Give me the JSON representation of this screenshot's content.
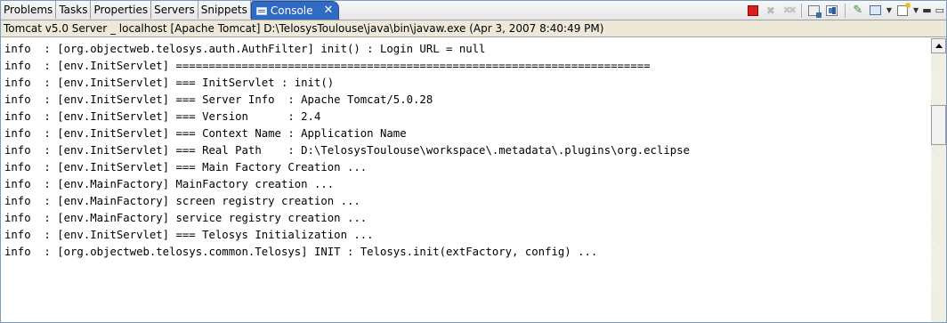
{
  "tabs": [
    {
      "label": "Problems"
    },
    {
      "label": "Tasks"
    },
    {
      "label": "Properties"
    },
    {
      "label": "Servers"
    },
    {
      "label": "Snippets"
    },
    {
      "label": "Console",
      "active": true
    }
  ],
  "tab_close_glyph": "✕",
  "toolbar": {
    "icons": [
      "terminate-icon",
      "remove-launch-icon",
      "remove-all-terminated-icon",
      "scroll-lock-icon",
      "clear-console-icon",
      "pin-console-icon",
      "display-selected-console-icon",
      "open-console-icon",
      "minimize-icon",
      "maximize-icon"
    ],
    "minimize_glyph": "▬",
    "maximize_glyph": "▭"
  },
  "description": "Tomcat v5.0 Server _ localhost [Apache Tomcat] D:\\TelosysToulouse\\java\\bin\\javaw.exe (Apr 3, 2007 8:40:49 PM)",
  "console_lines": [
    "info  : [org.objectweb.telosys.auth.AuthFilter] init() : Login URL = null",
    "info  : [env.InitServlet] ========================================================================",
    "info  : [env.InitServlet] === InitServlet : init()",
    "info  : [env.InitServlet] === Server Info  : Apache Tomcat/5.0.28",
    "info  : [env.InitServlet] === Version      : 2.4",
    "info  : [env.InitServlet] === Context Name : Application Name",
    "info  : [env.InitServlet] === Real Path    : D:\\TelosysToulouse\\workspace\\.metadata\\.plugins\\org.eclipse",
    "info  : [env.InitServlet] === Main Factory Creation ...",
    "info  : [env.MainFactory] MainFactory creation ...",
    "info  : [env.MainFactory] screen registry creation ...",
    "info  : [env.MainFactory] service registry creation ...",
    "info  : [env.InitServlet] === Telosys Initialization ...",
    "info  : [org.objectweb.telosys.common.Telosys] INIT : Telosys.init(extFactory, config) ..."
  ]
}
